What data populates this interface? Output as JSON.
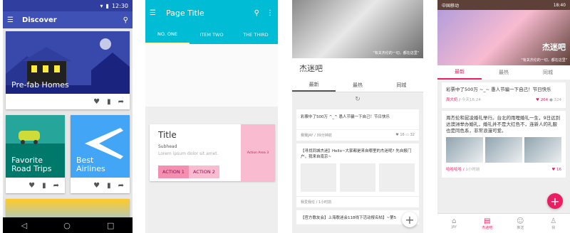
{
  "p1": {
    "time": "12:30",
    "title": "Discover",
    "cards": {
      "prefab": "Pre-fab Homes",
      "favorite": "Favorite\nRoad Trips",
      "airlines": "Best\nAirlines"
    }
  },
  "p2": {
    "title": "Page Title",
    "tabs": [
      "NO. ONE",
      "ITEM TWO",
      "THE THIRD"
    ],
    "card": {
      "title": "Title",
      "subhead": "Subhead",
      "body": "Lorem ipsum dolor sit amet.",
      "action1": "ACTION 1",
      "action2": "ACTION 2",
      "area": "Action Area 3"
    }
  },
  "p3": {
    "hero_quote": "\"有关杰伦的一切，都在这里\"",
    "title": "杰迷吧",
    "tabs": [
      "最新",
      "最热",
      "同城"
    ],
    "post1": {
      "text": "彩票中了500万 ^_^ 愚人节骗一下自己！节日快乐",
      "user": "赛赛JAY",
      "time": "39分钟前",
      "likes": "16",
      "comments": "32"
    },
    "post2": {
      "text": "【寻找同城杰迷】Hello~大家都是来自哪里的杰迷呢? 先自报门户，我来自南京~",
      "user": "我爱我伦",
      "time": "1小时前"
    },
    "post3": {
      "text": "【官方歌友会】上海歌迷会118线下活动报名帖】~第5"
    }
  },
  "p4": {
    "carrier": "中国移动",
    "time": "18:40",
    "hero_big": "杰迷吧",
    "hero_quote": "\"有关杰伦的一切，都在这里\"",
    "tabs": [
      "最新",
      "最热",
      "同城"
    ],
    "post1": {
      "text": "彩票中了500万 ~_~ 愚人节骗一下自己！节日快乐",
      "user": "周大奶",
      "time": "今天16:24",
      "likes": "264",
      "comments": "324"
    },
    "post2": {
      "text": "周杰伦和昆凌婚礼举行。台北的雨哩婚礼一生，9日远到达澳洲举办婚礼，婚礼并不是大红色不，连新人的礼服也是同色系，非常浪漫可爱。",
      "user": "哈哈哈哈",
      "time": "1小时前",
      "likes": "16"
    },
    "nav": [
      "JAY",
      "杰迷吧",
      "推送",
      "我"
    ]
  }
}
